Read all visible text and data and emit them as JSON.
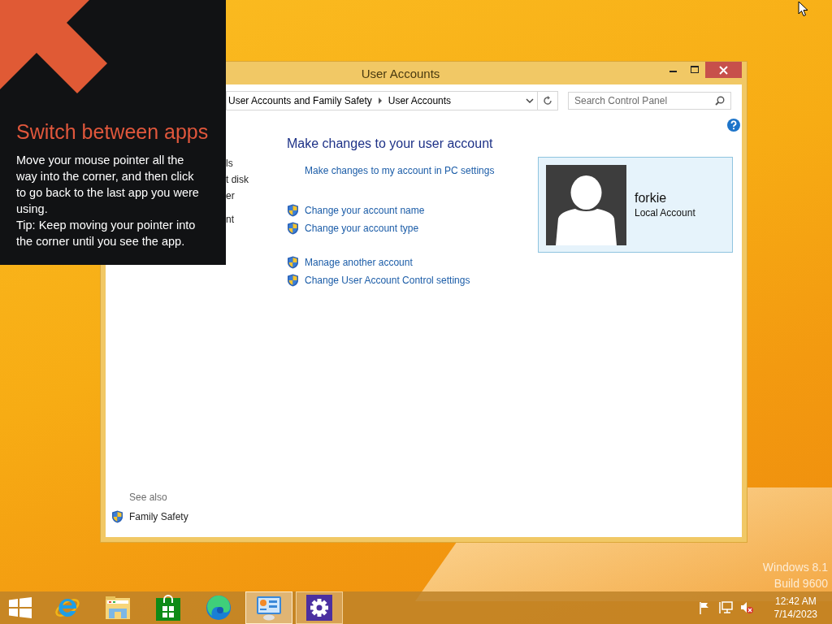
{
  "tip_overlay": {
    "title": "Switch between apps",
    "body": "Move your mouse pointer all the way into the corner, and then click to go back to the last app you were using.",
    "tip": "Tip: Keep moving your pointer into the corner until you see the app."
  },
  "window": {
    "title": "User Accounts",
    "breadcrumb": [
      "User Accounts and Family Safety",
      "User Accounts"
    ],
    "search": {
      "placeholder": "Search Control Panel"
    },
    "left_pane": {
      "groups": [
        [
          "ls",
          "t disk",
          "er"
        ],
        [
          "nt"
        ]
      ],
      "see_also": "See also",
      "see_also_links": [
        {
          "label": "Family Safety",
          "shield": true
        }
      ]
    },
    "heading": "Make changes to your user account",
    "task_groups": [
      [
        {
          "label": "Make changes to my account in PC settings",
          "shield": false
        }
      ],
      [
        {
          "label": "Change your account name",
          "shield": true
        },
        {
          "label": "Change your account type",
          "shield": true
        }
      ],
      [
        {
          "label": "Manage another account",
          "shield": true
        },
        {
          "label": "Change User Account Control settings",
          "shield": true
        }
      ]
    ],
    "account": {
      "name": "forkie",
      "type": "Local Account"
    }
  },
  "desktop": {
    "watermark": [
      "Windows 8.1",
      "Build 9600"
    ]
  },
  "taskbar": {
    "apps": [
      {
        "kind": "start",
        "running": false,
        "selected": false
      },
      {
        "kind": "ie",
        "running": false,
        "selected": false
      },
      {
        "kind": "explorer",
        "running": false,
        "selected": false
      },
      {
        "kind": "store",
        "running": false,
        "selected": false
      },
      {
        "kind": "edge",
        "running": false,
        "selected": false
      },
      {
        "kind": "control-panel",
        "running": true,
        "selected": true
      },
      {
        "kind": "settings",
        "running": true,
        "selected": false
      }
    ],
    "clock": {
      "time": "12:42 AM",
      "date": "7/14/2023"
    }
  }
}
